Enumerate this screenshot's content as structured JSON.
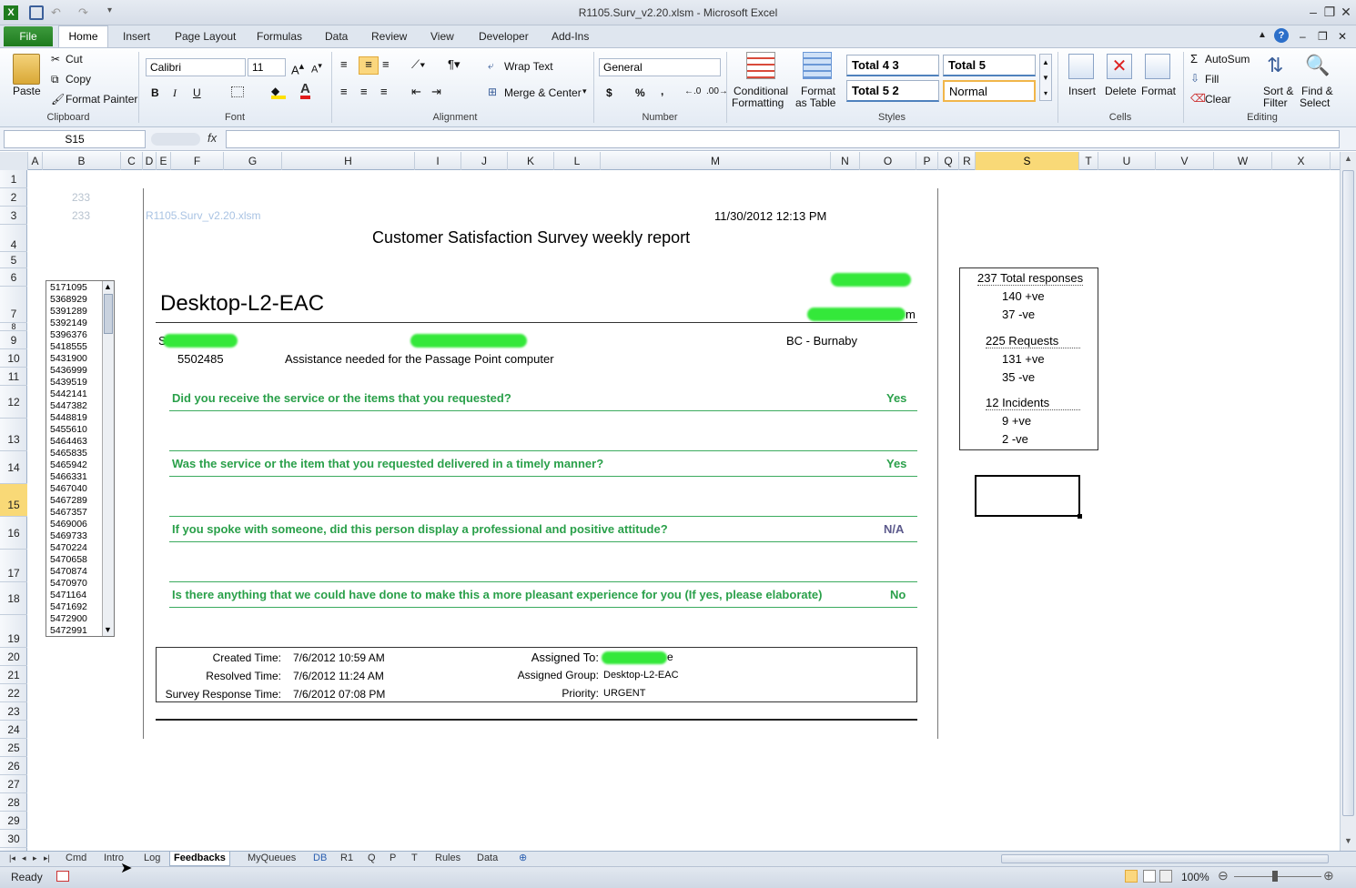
{
  "window": {
    "title": "R1105.Surv_v2.20.xlsm - Microsoft Excel"
  },
  "ribbon_tabs": [
    "File",
    "Home",
    "Insert",
    "Page Layout",
    "Formulas",
    "Data",
    "Review",
    "View",
    "Developer",
    "Add-Ins"
  ],
  "clipboard": {
    "paste": "Paste",
    "cut": "Cut",
    "copy": "Copy",
    "format_painter": "Format Painter",
    "label": "Clipboard"
  },
  "font": {
    "name": "Calibri",
    "size": "11",
    "label": "Font",
    "bold": "B",
    "italic": "I",
    "underline": "U"
  },
  "alignment": {
    "wrap": "Wrap Text",
    "merge": "Merge & Center",
    "label": "Alignment"
  },
  "number": {
    "format": "General",
    "currency": "$",
    "percent": "%",
    "comma": ",",
    "label": "Number"
  },
  "styles": {
    "conditional": "Conditional",
    "conditional2": "Formatting",
    "format_table": "Format",
    "format_table2": "as Table",
    "cells": [
      "Total 4 3",
      "Total 5",
      "Total 5 2",
      "Normal"
    ],
    "label": "Styles"
  },
  "cells_group": {
    "insert": "Insert",
    "delete": "Delete",
    "format": "Format",
    "label": "Cells"
  },
  "editing": {
    "autosum": "AutoSum",
    "fill": "Fill",
    "clear": "Clear",
    "sort": "Sort &",
    "sort2": "Filter",
    "find": "Find &",
    "find2": "Select",
    "label": "Editing"
  },
  "formula_bar": {
    "name_box": "S15",
    "fx": "fx",
    "value": ""
  },
  "columns": [
    "A",
    "B",
    "C",
    "D",
    "E",
    "F",
    "G",
    "H",
    "I",
    "J",
    "K",
    "L",
    "M",
    "N",
    "O",
    "P",
    "Q",
    "R",
    "S",
    "T",
    "U",
    "V",
    "W",
    "X"
  ],
  "rows": [
    "1",
    "2",
    "3",
    "4",
    "5",
    "6",
    "7",
    "8",
    "9",
    "10",
    "11",
    "12",
    "13",
    "14",
    "15",
    "16",
    "17",
    "18",
    "19",
    "20",
    "21",
    "22",
    "23",
    "24",
    "25",
    "26",
    "27",
    "28",
    "29",
    "30"
  ],
  "report": {
    "num_a": "233",
    "num_b": "233",
    "filename": "R1105.Surv_v2.20.xlsm",
    "timestamp": "11/30/2012 12:13 PM",
    "title": "Customer Satisfaction Survey weekly report",
    "group": "Desktop-L2-EAC",
    "trailing_m": "m",
    "leading_s": "S",
    "location": "BC - Burnaby",
    "ticket": "5502485",
    "description": "Assistance needed for the Passage Point computer",
    "questions": [
      {
        "q": "Did you receive the service or the items that you requested?",
        "a": "Yes"
      },
      {
        "q": "Was the service or the item that you requested delivered in a timely manner?",
        "a": "Yes"
      },
      {
        "q": "If you spoke with someone, did this person display a professional and positive attitude?",
        "a": "N/A"
      },
      {
        "q": "Is there anything that we could have done to make this a more pleasant experience for you (If yes, please elaborate)",
        "a": "No"
      }
    ],
    "details": {
      "created_label": "Created Time:",
      "created": "7/6/2012 10:59 AM",
      "resolved_label": "Resolved Time:",
      "resolved": "7/6/2012 11:24 AM",
      "survey_label": "Survey Response Time:",
      "survey": "7/6/2012 07:08 PM",
      "assigned_to_label": "Assigned To:",
      "assigned_to_tail": "e",
      "group_label": "Assigned Group:",
      "group": "Desktop-L2-EAC",
      "priority_label": "Priority:",
      "priority": "URGENT"
    }
  },
  "listbox_items": [
    "5171095",
    "5368929",
    "5391289",
    "5392149",
    "5396376",
    "5418555",
    "5431900",
    "5436999",
    "5439519",
    "5442141",
    "5447382",
    "5448819",
    "5455610",
    "5464463",
    "5465835",
    "5465942",
    "5466331",
    "5467040",
    "5467289",
    "5467357",
    "5469006",
    "5469733",
    "5470224",
    "5470658",
    "5470874",
    "5470970",
    "5471164",
    "5471692",
    "5472900",
    "5472991"
  ],
  "summary": [
    {
      "text": "237 Total responses",
      "head": true
    },
    {
      "text": "140 +ve",
      "head": false
    },
    {
      "text": "37 -ve",
      "head": false
    },
    {
      "text": "225 Requests",
      "head": true
    },
    {
      "text": "131 +ve",
      "head": false
    },
    {
      "text": "35 -ve",
      "head": false
    },
    {
      "text": "12 Incidents",
      "head": true
    },
    {
      "text": "9 +ve",
      "head": false
    },
    {
      "text": "2 -ve",
      "head": false
    }
  ],
  "sheet_tabs": [
    "Cmd",
    "Intro",
    "Log",
    "Feedbacks",
    "MyQueues",
    "DB",
    "R1",
    "Q",
    "P",
    "T",
    "Rules",
    "Data"
  ],
  "active_sheet": "Feedbacks",
  "status": {
    "ready": "Ready",
    "zoom": "100%"
  },
  "colors": {
    "accent_green": "#2aa04a",
    "selection": "#f9d977",
    "file_tab": "#1e7b1e"
  }
}
